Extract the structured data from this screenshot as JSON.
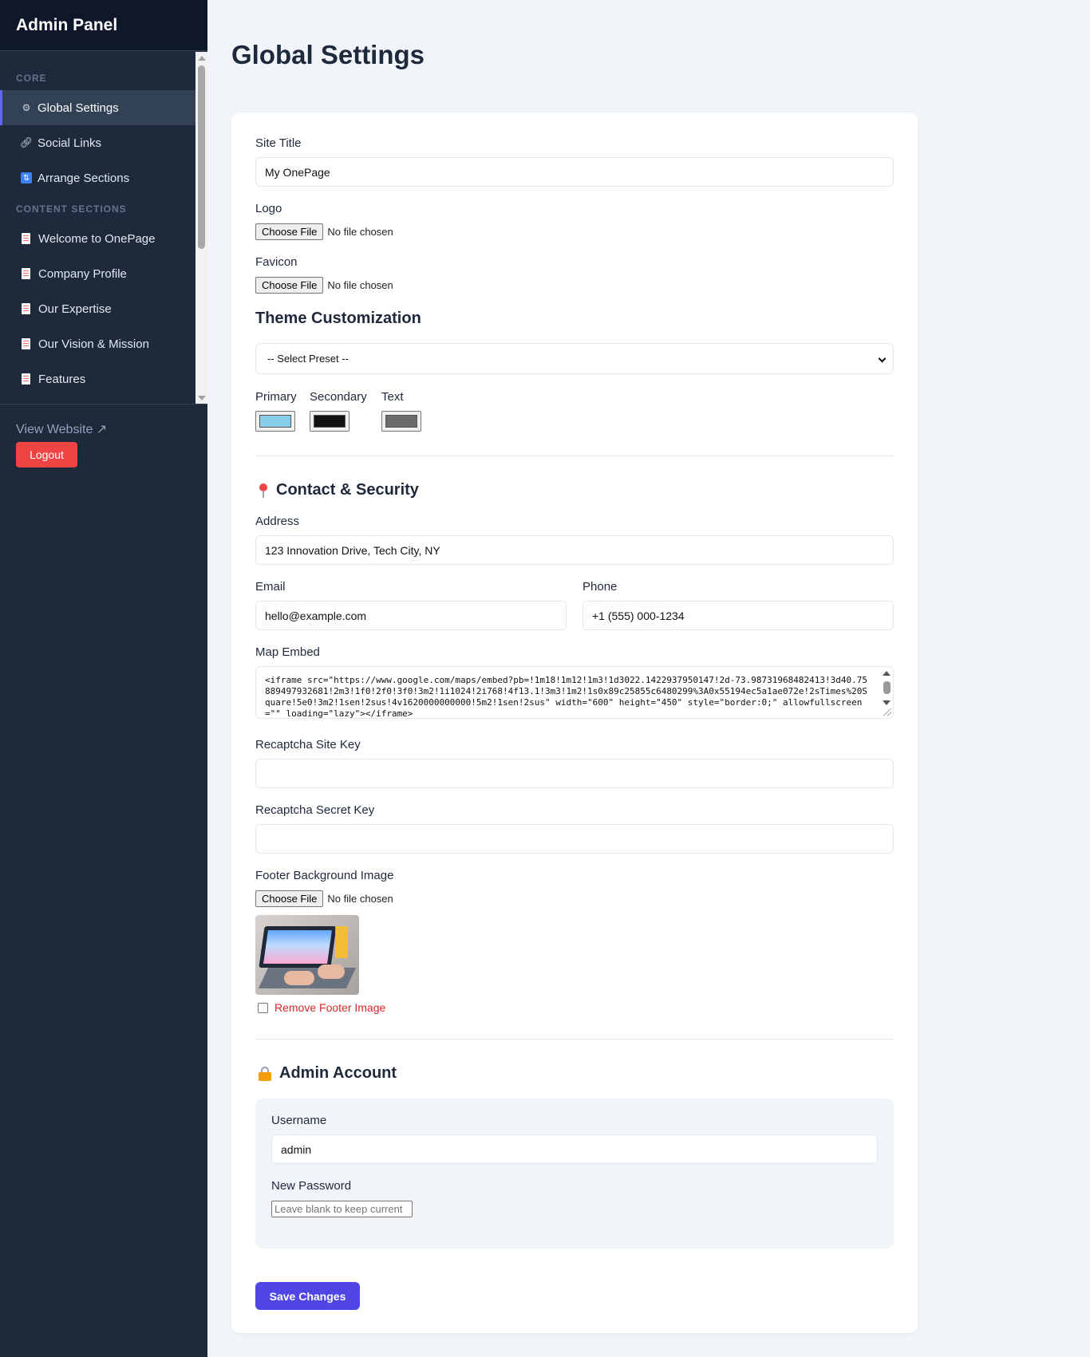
{
  "sidebar": {
    "brand": "Admin Panel",
    "sections": [
      {
        "title": "CORE",
        "items": [
          {
            "label": "Global Settings",
            "icon": "gear-icon",
            "active": true
          },
          {
            "label": "Social Links",
            "icon": "link-icon"
          },
          {
            "label": "Arrange Sections",
            "icon": "arrows-icon"
          }
        ]
      },
      {
        "title": "CONTENT SECTIONS",
        "items": [
          {
            "label": "Welcome to OnePage",
            "icon": "page-icon"
          },
          {
            "label": "Company Profile",
            "icon": "page-icon"
          },
          {
            "label": "Our Expertise",
            "icon": "page-icon"
          },
          {
            "label": "Our Vision & Mission",
            "icon": "page-icon"
          },
          {
            "label": "Features",
            "icon": "page-icon"
          }
        ]
      }
    ],
    "view_website": "View Website ↗",
    "logout": "Logout"
  },
  "page_title": "Global Settings",
  "form": {
    "site_title": {
      "label": "Site Title",
      "value": "My OnePage"
    },
    "logo": {
      "label": "Logo",
      "button": "Choose File",
      "status": "No file chosen"
    },
    "favicon": {
      "label": "Favicon",
      "button": "Choose File",
      "status": "No file chosen"
    },
    "theme": {
      "title": "Theme Customization",
      "preset": "-- Select Preset --",
      "colors": [
        {
          "label": "Primary",
          "value": "#87ceeb"
        },
        {
          "label": "Secondary",
          "value": "#111111"
        },
        {
          "label": "Text",
          "value": "#6b6b6b"
        }
      ]
    },
    "contact": {
      "title": "Contact & Security",
      "address": {
        "label": "Address",
        "value": "123 Innovation Drive, Tech City, NY"
      },
      "email": {
        "label": "Email",
        "value": "hello@example.com"
      },
      "phone": {
        "label": "Phone",
        "value": "+1 (555) 000-1234"
      },
      "map_embed": {
        "label": "Map Embed",
        "value": "<iframe src=\"https://www.google.com/maps/embed?pb=!1m18!1m12!1m3!1d3022.1422937950147!2d-73.98731968482413!3d40.75889497932681!2m3!1f0!2f0!3f0!3m2!1i1024!2i768!4f13.1!3m3!1m2!1s0x89c25855c6480299%3A0x55194ec5a1ae072e!2sTimes%20Square!5e0!3m2!1sen!2sus!4v1620000000000!5m2!1sen!2sus\" width=\"600\" height=\"450\" style=\"border:0;\" allowfullscreen=\"\" loading=\"lazy\"></iframe>"
      },
      "recaptcha_site": {
        "label": "Recaptcha Site Key",
        "value": ""
      },
      "recaptcha_secret": {
        "label": "Recaptcha Secret Key",
        "value": ""
      },
      "footer_bg": {
        "label": "Footer Background Image",
        "button": "Choose File",
        "status": "No file chosen",
        "remove_label": "Remove Footer Image"
      }
    },
    "admin": {
      "title": "Admin Account",
      "username": {
        "label": "Username",
        "value": "admin"
      },
      "password": {
        "label": "New Password",
        "placeholder": "Leave blank to keep current"
      }
    },
    "save": "Save Changes"
  }
}
